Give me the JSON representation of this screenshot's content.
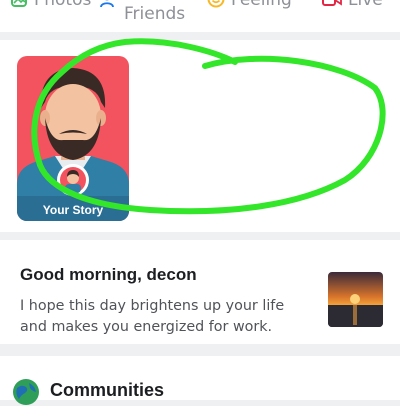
{
  "composer": {
    "photos_label": "Photos",
    "tag_friends_label": "Friends",
    "feeling_label": "Feeling",
    "live_label": "Live"
  },
  "stories": {
    "your_story_label": "Your Story"
  },
  "greeting": {
    "title": "Good morning, decon",
    "message": "I hope this day brightens up your life and makes you energized for work."
  },
  "communities": {
    "label": "Communities"
  },
  "colors": {
    "story_background": "#f2535e",
    "scribble": "#33e62a",
    "photos_icon": "#45bd62",
    "feeling_icon": "#f7b928",
    "live_icon": "#e42645"
  },
  "icons": [
    "photo-icon",
    "tag-friends-icon",
    "feeling-icon",
    "live-icon",
    "avatar-icon",
    "sunset-thumbnail",
    "globe-icon"
  ]
}
